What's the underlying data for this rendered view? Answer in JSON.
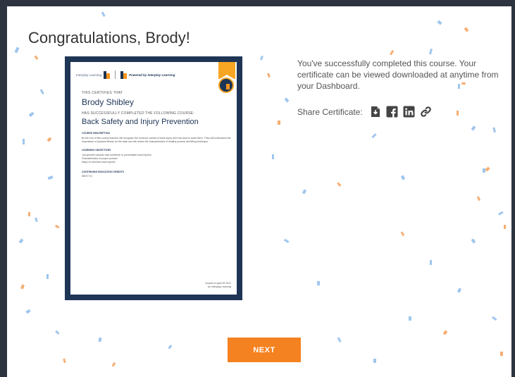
{
  "title": "Congratulations, Brody!",
  "message": "You've successfully completed this course. Your certificate can be viewed downloaded at anytime from your Dashboard.",
  "share": {
    "label": "Share Certificate:",
    "icons": [
      "download-file-icon",
      "facebook-icon",
      "linkedin-icon",
      "link-icon"
    ]
  },
  "certificate": {
    "logo_text": "Interplay Learning",
    "powered_by": "Powered by Interplay Learning",
    "certifies_label": "THIS CERTIFIES THAT",
    "recipient": "Brody Shibley",
    "completed_label": "HAS SUCCESSFULLY COMPLETED THE FOLLOWING COURSE:",
    "course": "Back Safety and Injury Prevention",
    "description_label": "COURSE DESCRIPTION",
    "description": "By the end of this course learners will recognize the common causes of back injury and how best to avoid them. They will understand the importance of physical fitness for the back and will review the characteristics of healthy posture and lifting technique.",
    "objectives_label": "LEARNING OBJECTIVES",
    "objectives": [
      "Job-specific hazards that contribute to preventable back injuries",
      "Characteristics of proper posture",
      "Ways to minimize back injuries"
    ],
    "credits_label": "CONTINUING EDUCATION CREDITS",
    "credits": "WEST 01",
    "issued_line1": "Issued on April 28 2021",
    "issued_line2": "by Interplay Learning"
  },
  "next_button": "NEXT",
  "colors": {
    "accent": "#f58220",
    "navy": "#1e3555",
    "ribbon": "#f6a623",
    "confetti_blue": "#4a90d9",
    "confetti_orange": "#f5a05a"
  }
}
